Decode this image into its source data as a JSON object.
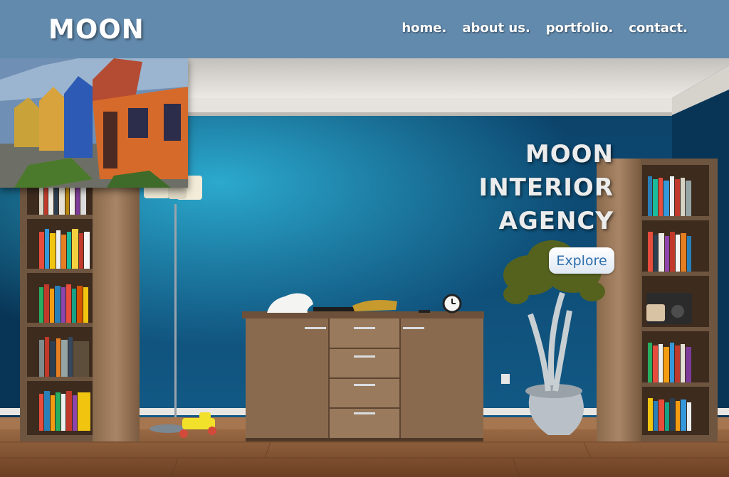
{
  "header": {
    "logo": "MOON",
    "nav": [
      {
        "label": "home."
      },
      {
        "label": "about us."
      },
      {
        "label": "portfolio."
      },
      {
        "label": "contact."
      }
    ]
  },
  "hero": {
    "lines": [
      "MOON",
      "INTERIOR",
      "AGENCY"
    ],
    "button_label": "Explore"
  },
  "colors": {
    "header_bg": "#628aad",
    "wall": "#0f4a75",
    "button_text": "#2d6fae"
  }
}
